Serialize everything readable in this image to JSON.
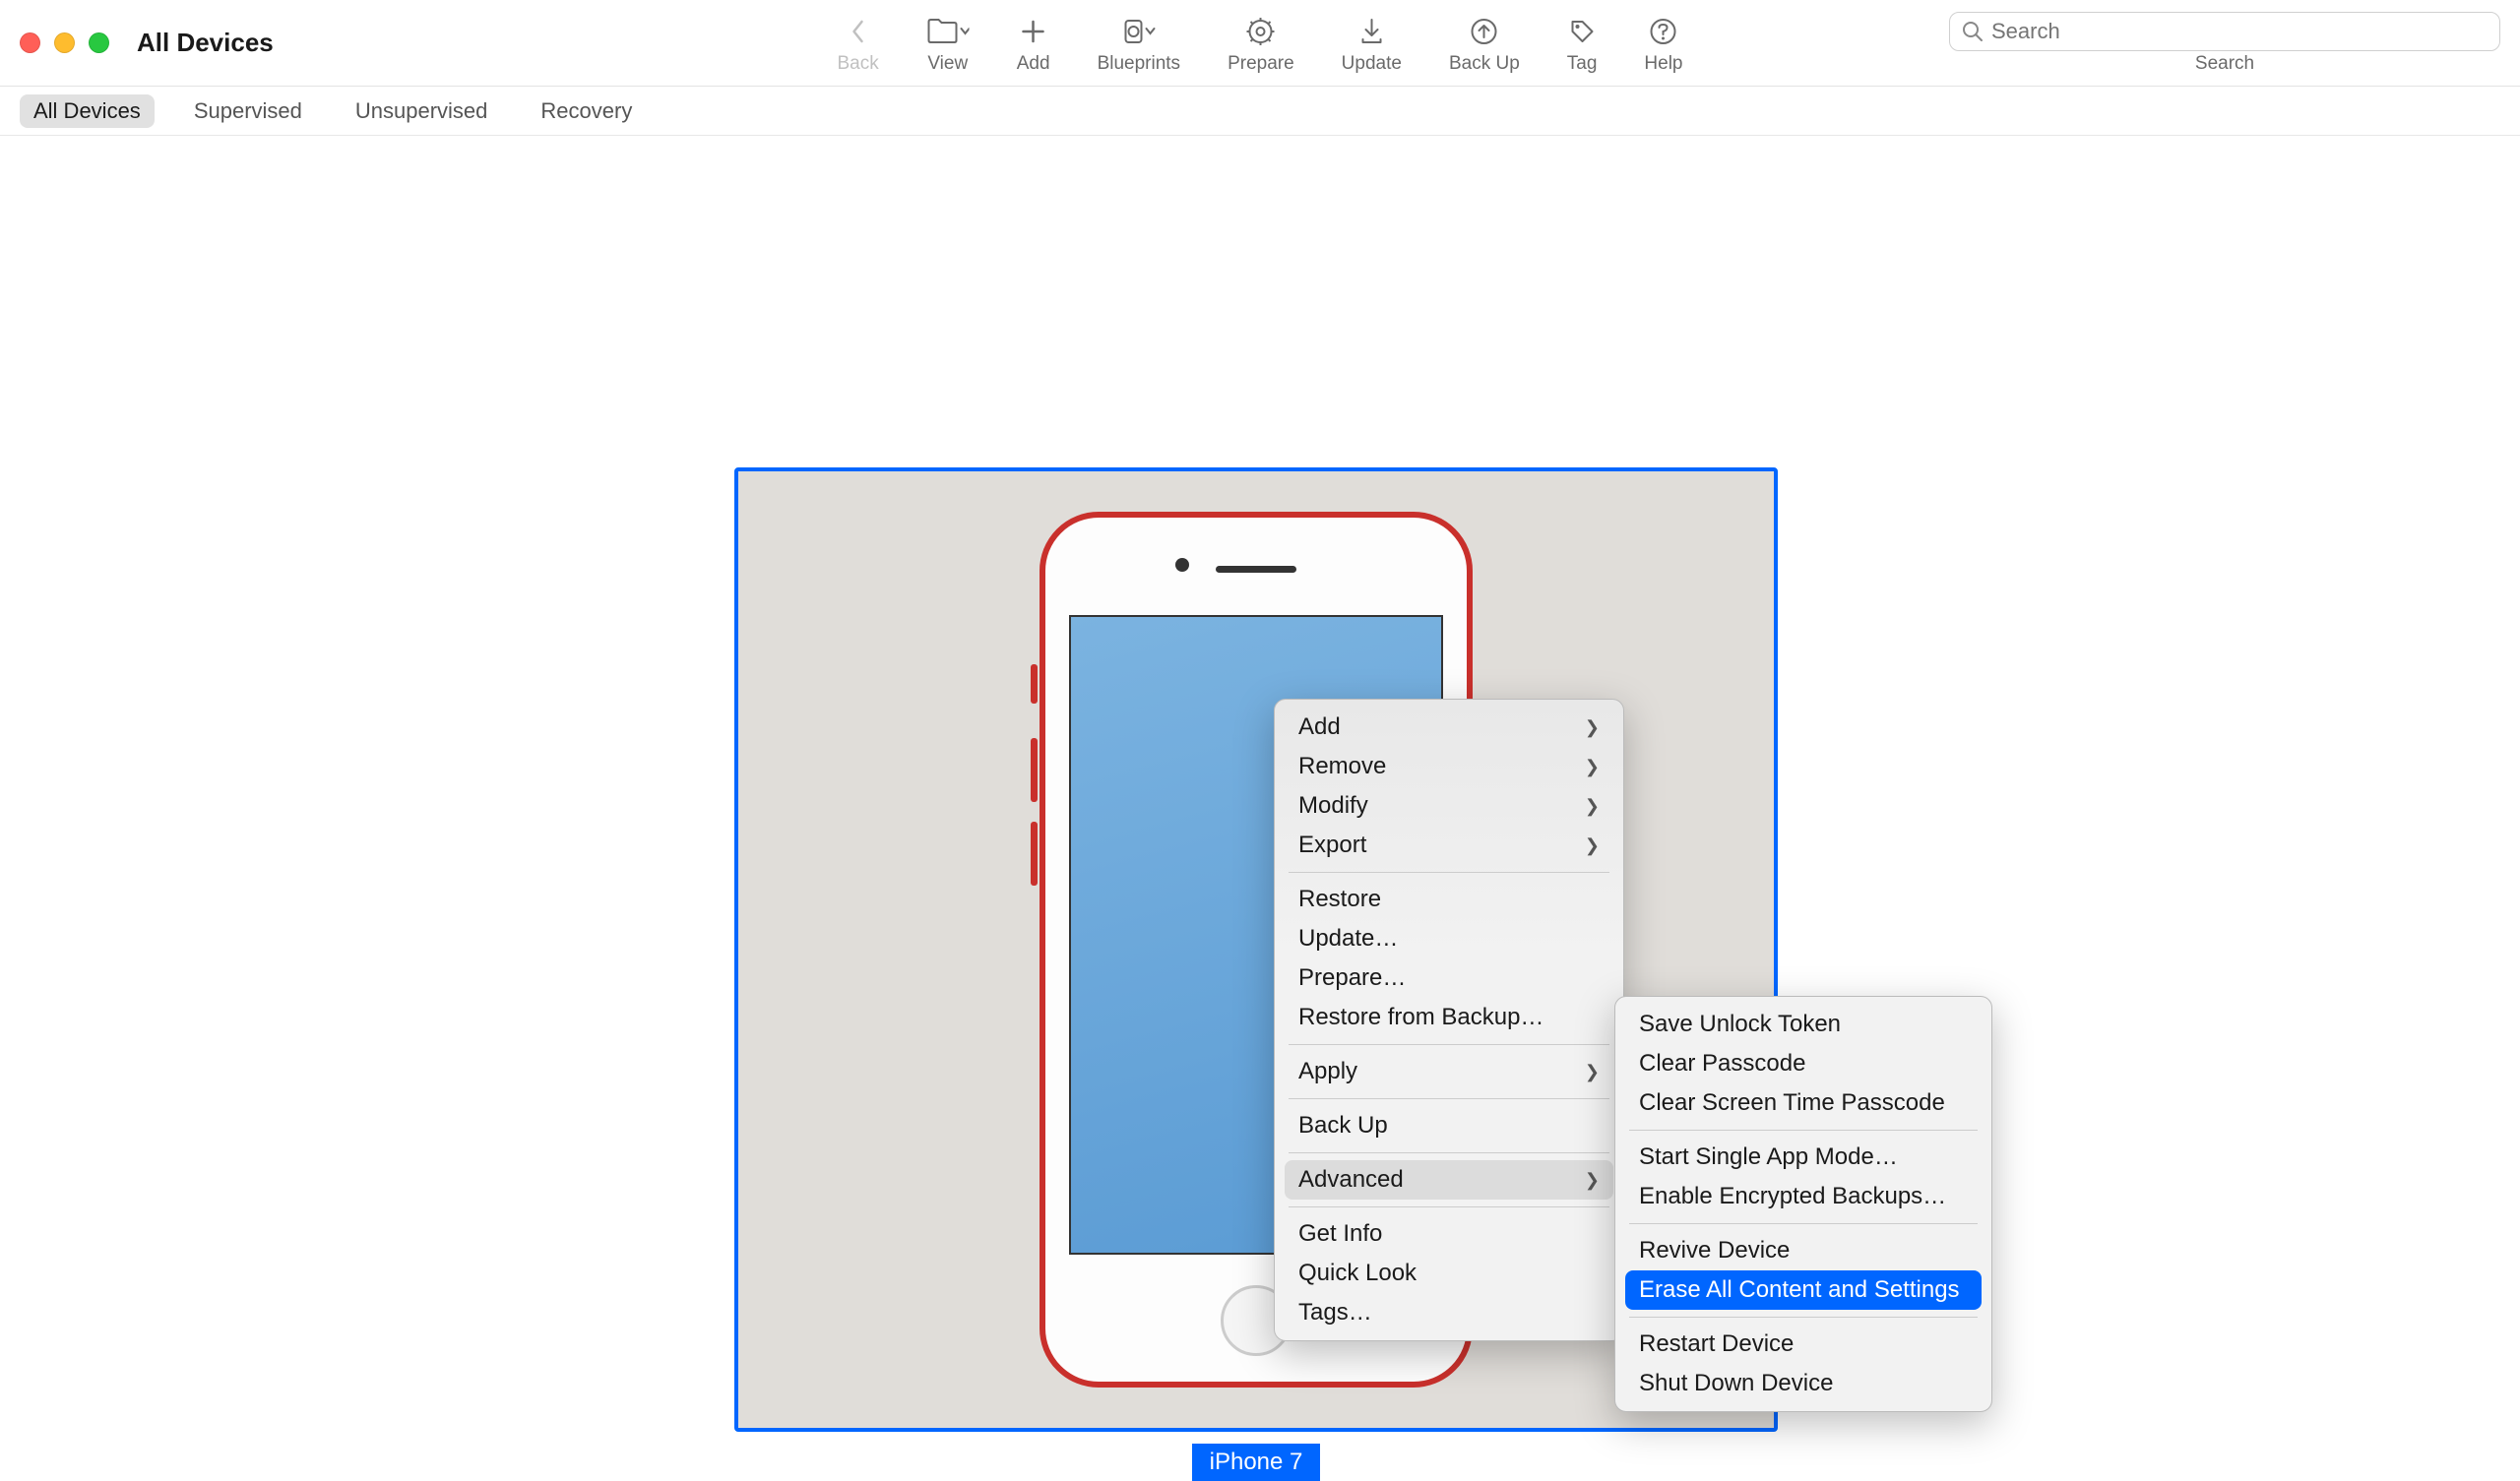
{
  "window": {
    "title": "All Devices"
  },
  "toolbar": {
    "back": "Back",
    "view": "View",
    "add": "Add",
    "blueprints": "Blueprints",
    "prepare": "Prepare",
    "update": "Update",
    "backup": "Back Up",
    "tag": "Tag",
    "help": "Help"
  },
  "search": {
    "placeholder": "Search",
    "label": "Search"
  },
  "filters": {
    "all": "All Devices",
    "supervised": "Supervised",
    "unsupervised": "Unsupervised",
    "recovery": "Recovery"
  },
  "device": {
    "name": "iPhone 7"
  },
  "contextMenu": {
    "add": "Add",
    "remove": "Remove",
    "modify": "Modify",
    "export": "Export",
    "restore": "Restore",
    "update": "Update…",
    "prepare": "Prepare…",
    "restoreBackup": "Restore from Backup…",
    "apply": "Apply",
    "backup": "Back Up",
    "advanced": "Advanced",
    "getInfo": "Get Info",
    "quickLook": "Quick Look",
    "tags": "Tags…"
  },
  "submenu": {
    "saveToken": "Save Unlock Token",
    "clearPasscode": "Clear Passcode",
    "clearScreenTime": "Clear Screen Time Passcode",
    "singleApp": "Start Single App Mode…",
    "encryptedBackups": "Enable Encrypted Backups…",
    "revive": "Revive Device",
    "erase": "Erase All Content and Settings",
    "restart": "Restart Device",
    "shutdown": "Shut Down Device"
  }
}
